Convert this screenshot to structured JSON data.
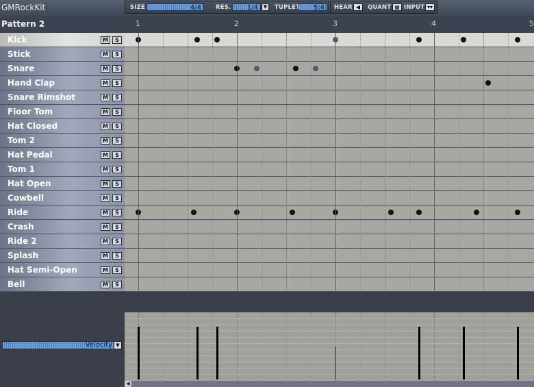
{
  "app": {
    "kit_name": "GMRockKit"
  },
  "toolbar": {
    "size_label": "SIZE",
    "size_value": "4/4",
    "res_label": "RES.",
    "res_value": "1/4",
    "tuplet_label": "TUPLET",
    "tuplet_value": "5:4",
    "hear_label": "HEAR",
    "quant_label": "QUANT",
    "input_label": "INPUT"
  },
  "pattern": {
    "name": "Pattern 2",
    "beats": [
      "1",
      "2",
      "3",
      "4",
      "5"
    ]
  },
  "instruments": [
    {
      "name": "Kick",
      "selected": true
    },
    {
      "name": "Stick"
    },
    {
      "name": "Snare"
    },
    {
      "name": "Hand Clap"
    },
    {
      "name": "Snare Rimshot"
    },
    {
      "name": "Floor Tom"
    },
    {
      "name": "Hat Closed"
    },
    {
      "name": "Tom 2"
    },
    {
      "name": "Hat Pedal"
    },
    {
      "name": "Tom 1"
    },
    {
      "name": "Hat Open"
    },
    {
      "name": "Cowbell"
    },
    {
      "name": "Ride"
    },
    {
      "name": "Crash"
    },
    {
      "name": "Ride 2"
    },
    {
      "name": "Splash"
    },
    {
      "name": "Hat Semi-Open"
    },
    {
      "name": "Bell"
    }
  ],
  "mute_label": "M",
  "solo_label": "S",
  "notes": [
    {
      "row": 0,
      "beat": 1.0
    },
    {
      "row": 0,
      "beat": 1.6
    },
    {
      "row": 0,
      "beat": 1.8
    },
    {
      "row": 0,
      "beat": 3.0,
      "soft": true
    },
    {
      "row": 0,
      "beat": 3.85
    },
    {
      "row": 0,
      "beat": 4.3
    },
    {
      "row": 0,
      "beat": 4.85
    },
    {
      "row": 2,
      "beat": 2.0
    },
    {
      "row": 2,
      "beat": 2.2,
      "soft": true
    },
    {
      "row": 2,
      "beat": 2.6
    },
    {
      "row": 2,
      "beat": 2.8,
      "soft": true
    },
    {
      "row": 3,
      "beat": 4.55
    },
    {
      "row": 12,
      "beat": 1.0
    },
    {
      "row": 12,
      "beat": 1.56
    },
    {
      "row": 12,
      "beat": 2.0
    },
    {
      "row": 12,
      "beat": 2.56
    },
    {
      "row": 12,
      "beat": 3.0
    },
    {
      "row": 12,
      "beat": 3.56
    },
    {
      "row": 12,
      "beat": 3.85
    },
    {
      "row": 12,
      "beat": 4.43
    },
    {
      "row": 12,
      "beat": 4.85
    }
  ],
  "velocity": {
    "label": "Velocity",
    "bars": [
      {
        "beat": 1.0,
        "level": 0.79
      },
      {
        "beat": 1.6,
        "level": 0.79
      },
      {
        "beat": 1.8,
        "level": 0.79
      },
      {
        "beat": 3.0,
        "level": 0.49,
        "soft": true
      },
      {
        "beat": 3.85,
        "level": 0.79
      },
      {
        "beat": 4.3,
        "level": 0.79
      },
      {
        "beat": 4.85,
        "level": 0.79
      }
    ]
  }
}
